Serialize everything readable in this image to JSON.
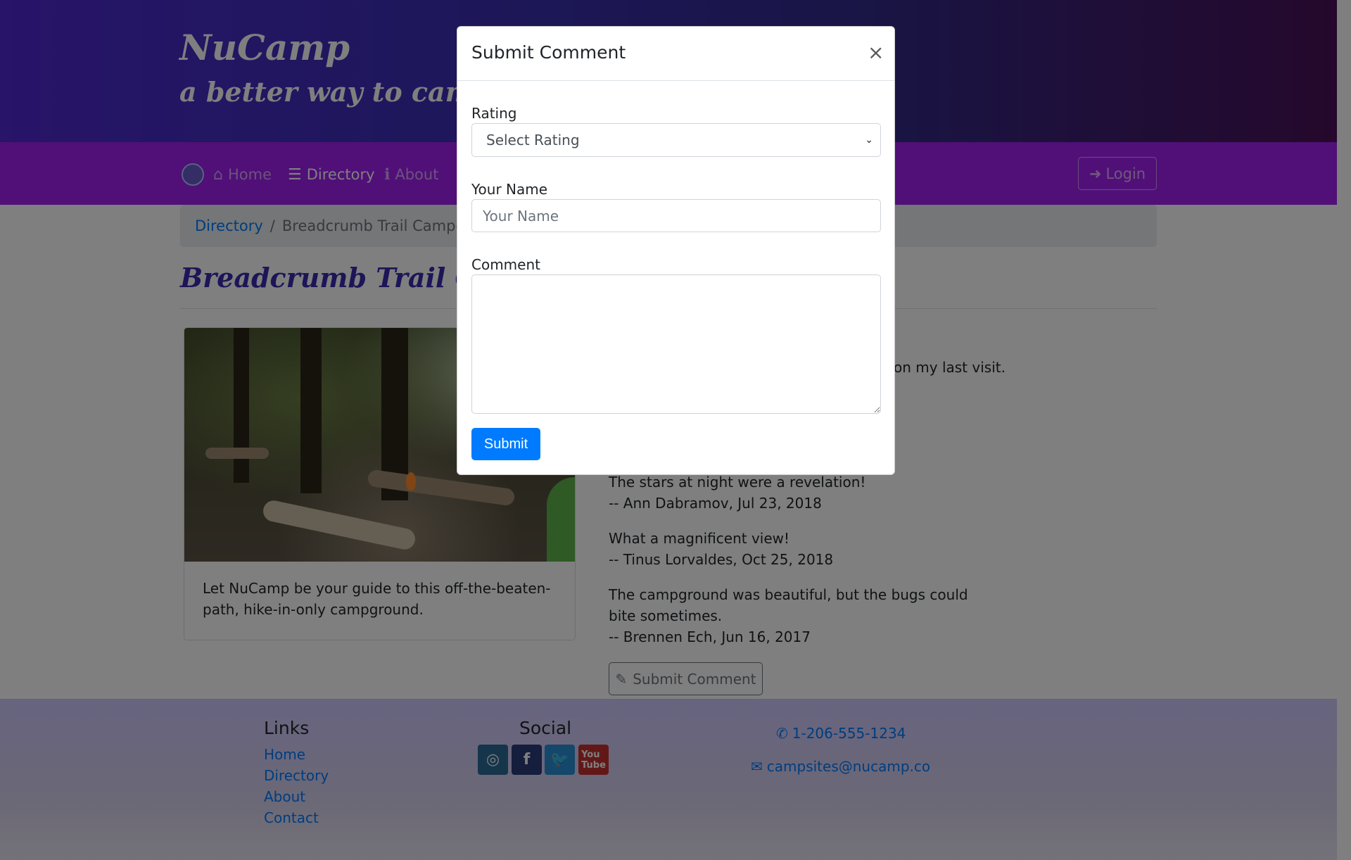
{
  "brand": {
    "title": "NuCamp",
    "subtitle": "a better way to camp"
  },
  "nav": {
    "items": [
      {
        "label": "Home",
        "icon": "home-icon"
      },
      {
        "label": "Directory",
        "icon": "list-icon"
      },
      {
        "label": "About",
        "icon": "info-icon"
      }
    ],
    "login_label": "Login"
  },
  "breadcrumb": {
    "link": "Directory",
    "separator": "/",
    "current": "Breadcrumb Trail Campgrou"
  },
  "page": {
    "heading": "Breadcrumb Trail Campg",
    "card_text": "Let NuCamp be your guide to this off-the-beaten-path, hike-in-only campground.",
    "partial_comment": "on my last visit.",
    "comments": [
      {
        "text": "The stars at night were a revelation!",
        "author": "-- Ann Dabramov, Jul 23, 2018"
      },
      {
        "text": "What a magnificent view!",
        "author": "-- Tinus Lorvaldes, Oct 25, 2018"
      },
      {
        "text": "The campground was beautiful, but the bugs could bite sometimes.",
        "author": "-- Brennen Ech, Jun 16, 2017"
      }
    ],
    "submit_comment_label": "Submit Comment"
  },
  "footer": {
    "links_heading": "Links",
    "links": [
      "Home",
      "Directory",
      "About",
      "Contact"
    ],
    "social_heading": "Social",
    "social": [
      "instagram-icon",
      "facebook-icon",
      "twitter-icon",
      "youtube-icon"
    ],
    "phone": "1-206-555-1234",
    "email": "campsites@nucamp.co"
  },
  "modal": {
    "title": "Submit Comment",
    "close": "×",
    "rating_label": "Rating",
    "rating_value": "Select Rating",
    "name_label": "Your Name",
    "name_placeholder": "Your Name",
    "comment_label": "Comment",
    "submit_label": "Submit"
  },
  "colors": {
    "brand_blue": "#3a2bb0",
    "navbar_purple": "#a020f0",
    "primary": "#007bff"
  }
}
